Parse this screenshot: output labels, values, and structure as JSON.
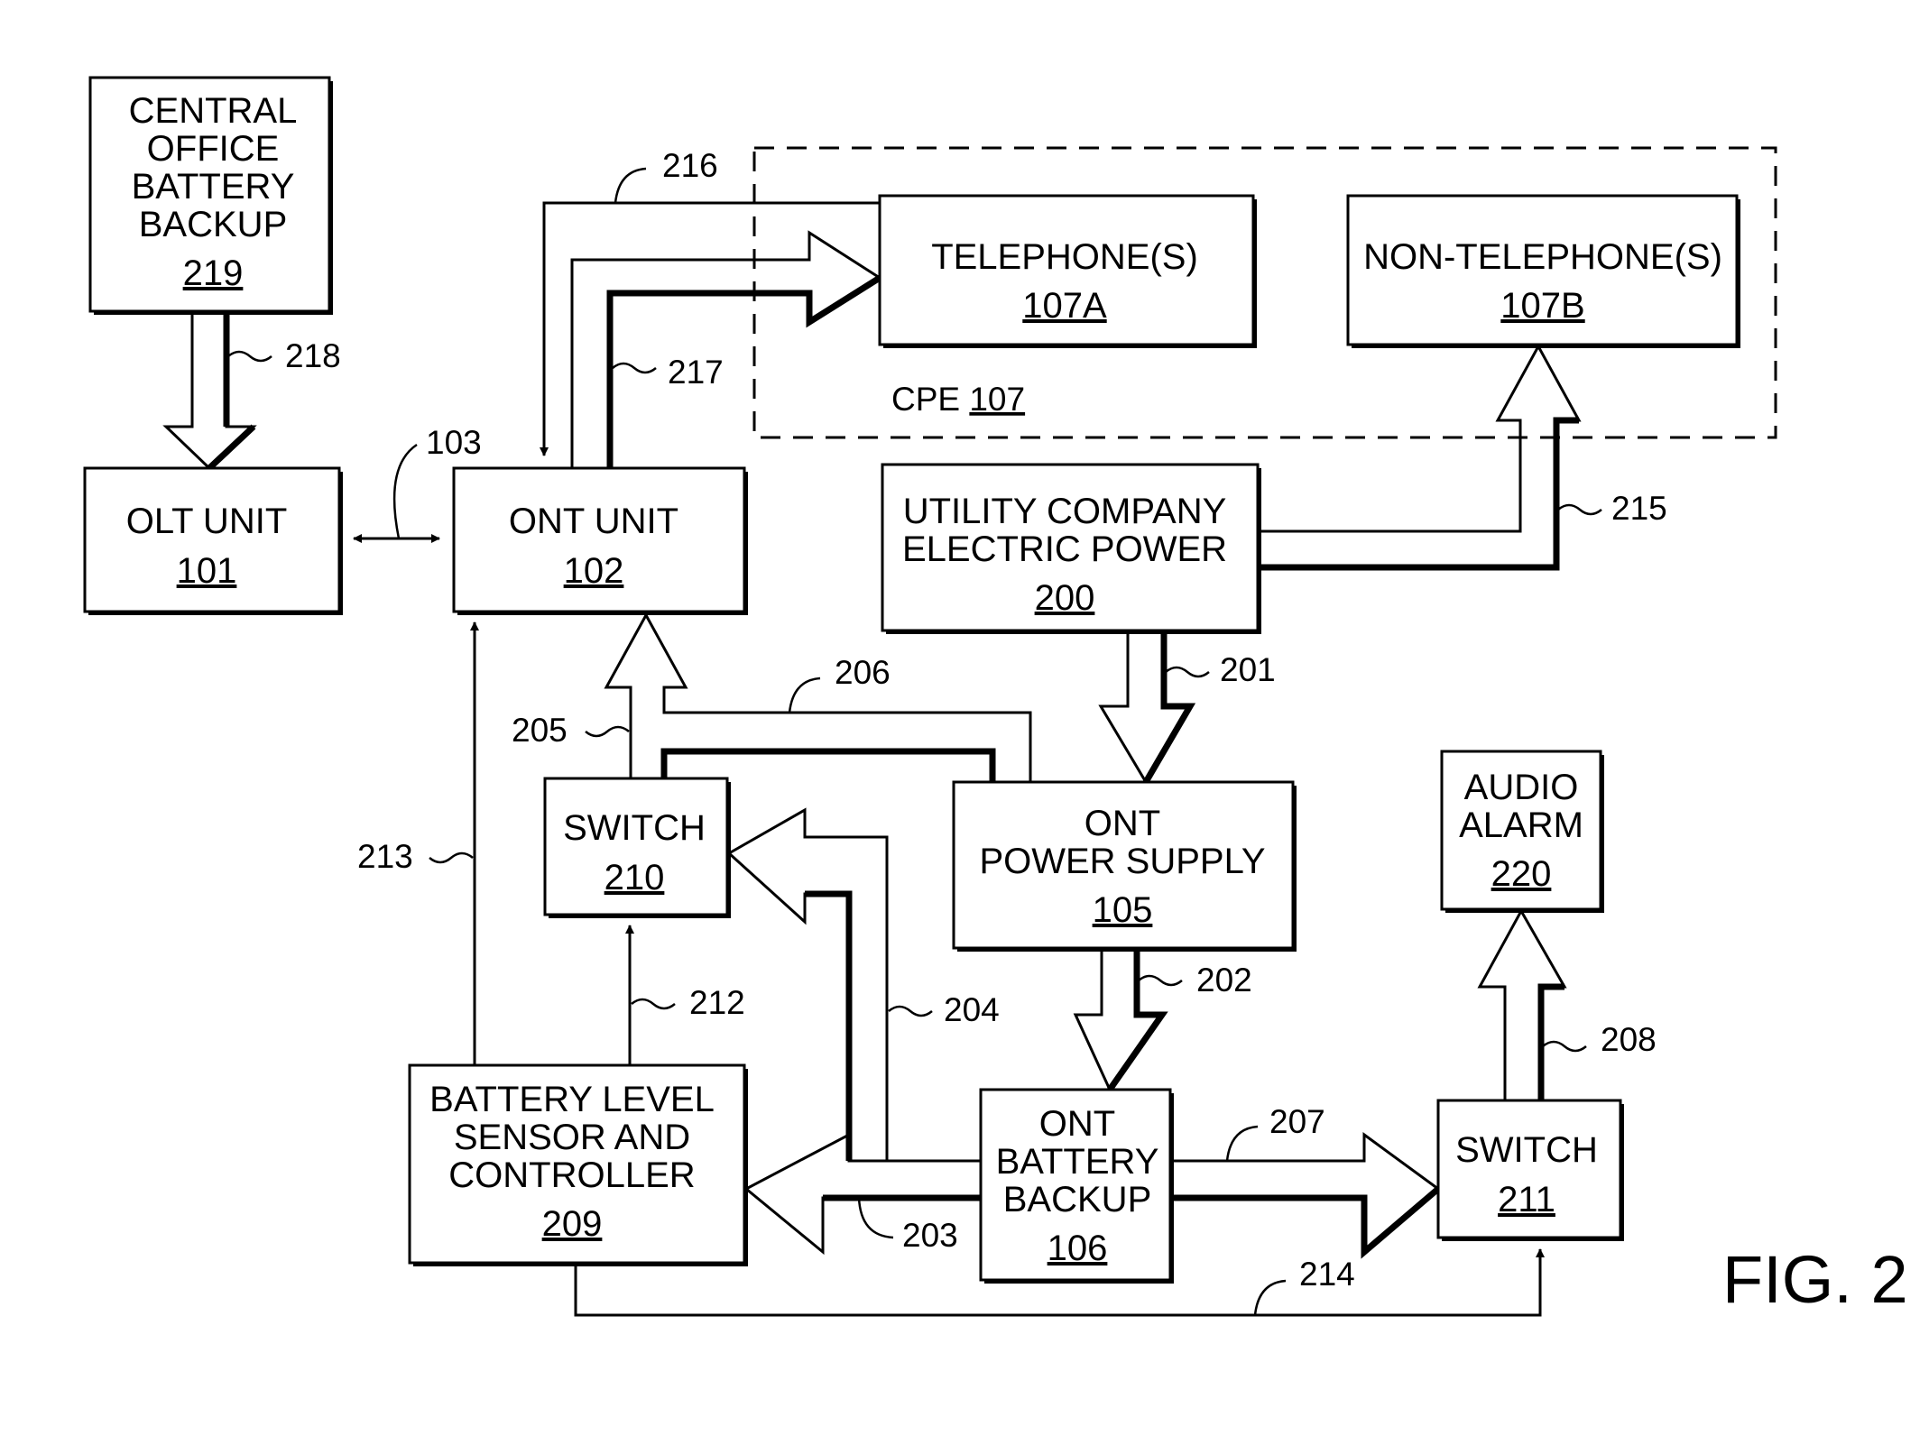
{
  "figure_label": "FIG. 2",
  "blocks": {
    "co_battery": {
      "lines": [
        "CENTRAL",
        "OFFICE",
        "BATTERY",
        "BACKUP"
      ],
      "ref": "219"
    },
    "olt": {
      "lines": [
        "OLT UNIT"
      ],
      "ref": "101"
    },
    "ont": {
      "lines": [
        "ONT UNIT"
      ],
      "ref": "102"
    },
    "telephones": {
      "lines": [
        "TELEPHONE(S)"
      ],
      "ref": "107A"
    },
    "non_telephones": {
      "lines": [
        "NON-TELEPHONE(S)"
      ],
      "ref": "107B"
    },
    "utility": {
      "lines": [
        "UTILITY COMPANY",
        "ELECTRIC POWER"
      ],
      "ref": "200"
    },
    "switch_210": {
      "lines": [
        "SWITCH"
      ],
      "ref": "210"
    },
    "ont_power_supply": {
      "lines": [
        "ONT",
        "POWER SUPPLY"
      ],
      "ref": "105"
    },
    "audio_alarm": {
      "lines": [
        "AUDIO",
        "ALARM"
      ],
      "ref": "220"
    },
    "battery_controller": {
      "lines": [
        "BATTERY LEVEL",
        "SENSOR AND",
        "CONTROLLER"
      ],
      "ref": "209"
    },
    "ont_battery": {
      "lines": [
        "ONT",
        "BATTERY",
        "BACKUP"
      ],
      "ref": "106"
    },
    "switch_211": {
      "lines": [
        "SWITCH"
      ],
      "ref": "211"
    }
  },
  "cpe": {
    "label": "CPE",
    "ref": "107"
  },
  "connection_refs": {
    "c103": "103",
    "c201": "201",
    "c202": "202",
    "c203": "203",
    "c204": "204",
    "c205": "205",
    "c206": "206",
    "c207": "207",
    "c208": "208",
    "c212": "212",
    "c213": "213",
    "c214": "214",
    "c215": "215",
    "c216": "216",
    "c217": "217",
    "c218": "218"
  }
}
